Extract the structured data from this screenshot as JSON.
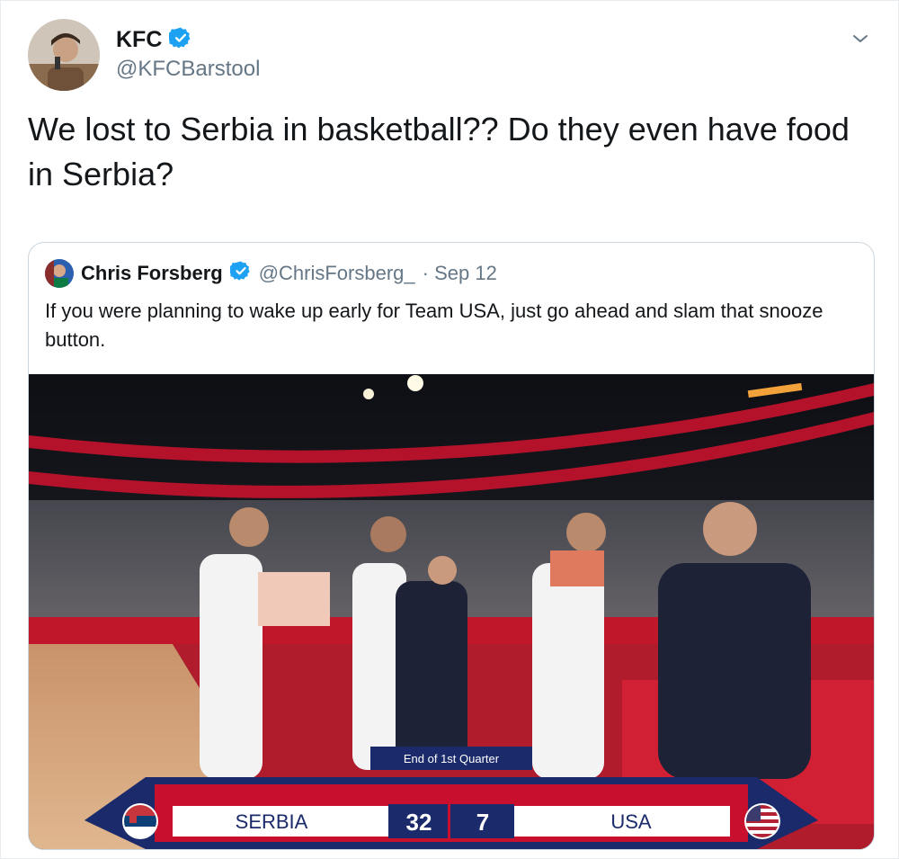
{
  "tweet": {
    "author": {
      "name": "KFC",
      "handle": "@KFCBarstool",
      "verified_icon": "verified-badge-icon"
    },
    "text": "We lost to Serbia in basketball?? Do they even have food in Serbia?",
    "menu_icon": "chevron-down-icon"
  },
  "quoted_tweet": {
    "author": {
      "name": "Chris Forsberg",
      "handle": "@ChrisForsberg_",
      "verified_icon": "verified-badge-icon"
    },
    "date": "· Sep 12",
    "text": "If you were planning to wake up early for Team USA, just go ahead and slam that snooze button.",
    "media": {
      "scoreboard": {
        "period": "End of 1st Quarter",
        "home_team": "SERBIA",
        "home_score": "32",
        "away_score": "7",
        "away_team": "USA"
      }
    }
  },
  "colors": {
    "verified": "#1da1f2",
    "secondary_text": "#657786",
    "border": "#ccd6dd",
    "scoreboard_red": "#c8102e",
    "scoreboard_navy": "#1b2a6b"
  }
}
